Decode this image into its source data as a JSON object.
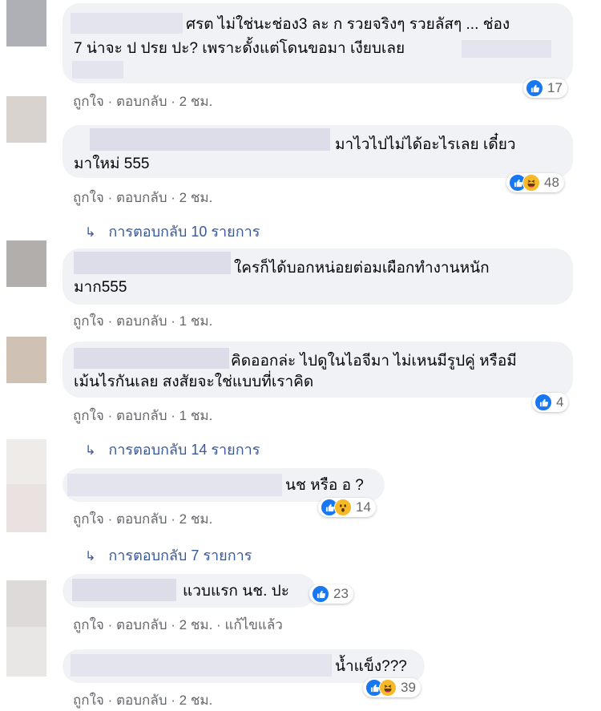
{
  "actions": {
    "like": "ถูกใจ",
    "sep": "·",
    "reply": "ตอบกลับ",
    "edited": "แก้ไขแล้ว"
  },
  "comments": [
    {
      "line1": "ศรต ไม่ใช่นะช่อง3 ละ ก รวยจริงๆ รวยลัสๆ ... ช่อง",
      "line2": "7 น่าจะ ป ปรย ปะ? เพราะดั้งแต่โดนขอมา เงียบเลย",
      "time": "2 ชม.",
      "reaction_count": "17",
      "reactions": [
        "like"
      ]
    },
    {
      "line1": "มาไวไปไม่ได้อะไรเลย เดี๋ยว",
      "line2": "มาใหม่ 555",
      "time": "2 ชม.",
      "reaction_count": "48",
      "reactions": [
        "like",
        "haha"
      ]
    },
    {
      "line1": "ใครก็ได้บอกหน่อยต่อมเผือกทำงานหนัก",
      "line2": "มาก555",
      "time": "1 ชม."
    },
    {
      "line1": "คิดออกล่ะ ไปดูในไอจีมา ไม่เหนมีรูปคู่ หรือมี",
      "line2": "เม้นไรกันเลย สงสัยจะใช่แบบที่เราคิด",
      "time": "1 ชม.",
      "reaction_count": "4",
      "reactions": [
        "like"
      ]
    },
    {
      "line1": "นช หรือ อ ?",
      "time": "2 ชม.",
      "reaction_count": "14",
      "reactions": [
        "like",
        "wow"
      ]
    },
    {
      "line1": "แวบแรก นช. ปะ",
      "time": "2 ชม.",
      "edited": true,
      "reaction_count": "23",
      "reactions": [
        "like"
      ]
    },
    {
      "line1": "น้ำแข็ง???",
      "time": "2 ชม.",
      "reaction_count": "39",
      "reactions": [
        "like",
        "haha"
      ]
    }
  ],
  "reply_links": [
    "การตอบกลับ 10 รายการ",
    "การตอบกลับ 14 รายการ",
    "การตอบกลับ 7 รายการ"
  ],
  "colors": {
    "bubble": "#f0f2f5",
    "meta_text": "#65676b",
    "link": "#385898",
    "like_blue": "#1877f2",
    "emoji_yellow": "#f7b928"
  }
}
